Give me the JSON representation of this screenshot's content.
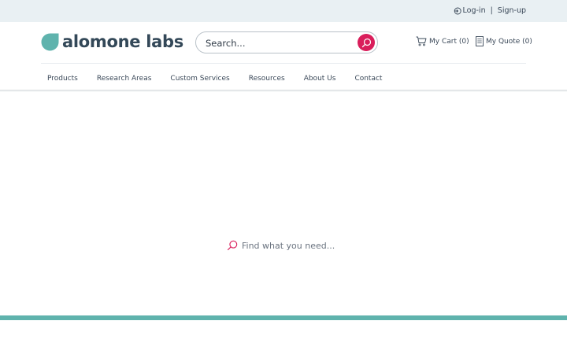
{
  "topbar": {
    "login_label": "Log-in",
    "separator": "|",
    "signup_label": "Sign-up"
  },
  "logo": {
    "text": "alomone labs",
    "mark_color": "#5fb3ad"
  },
  "search": {
    "placeholder": "Search..."
  },
  "header": {
    "cart_label": "My Cart (0)",
    "quote_label": "My Quote (0)"
  },
  "nav": {
    "items": [
      {
        "label": "Products"
      },
      {
        "label": "Research Areas"
      },
      {
        "label": "Custom Services"
      },
      {
        "label": "Resources"
      },
      {
        "label": "About Us"
      },
      {
        "label": "Contact"
      }
    ]
  },
  "main": {
    "find_label": "Find what you need..."
  },
  "colors": {
    "accent": "#d91e5b",
    "teal": "#5fb3ad",
    "topbar_bg": "#e9f0f3"
  },
  "icons": [
    "login-icon",
    "search-icon",
    "cart-icon",
    "quote-icon",
    "find-search-icon"
  ]
}
